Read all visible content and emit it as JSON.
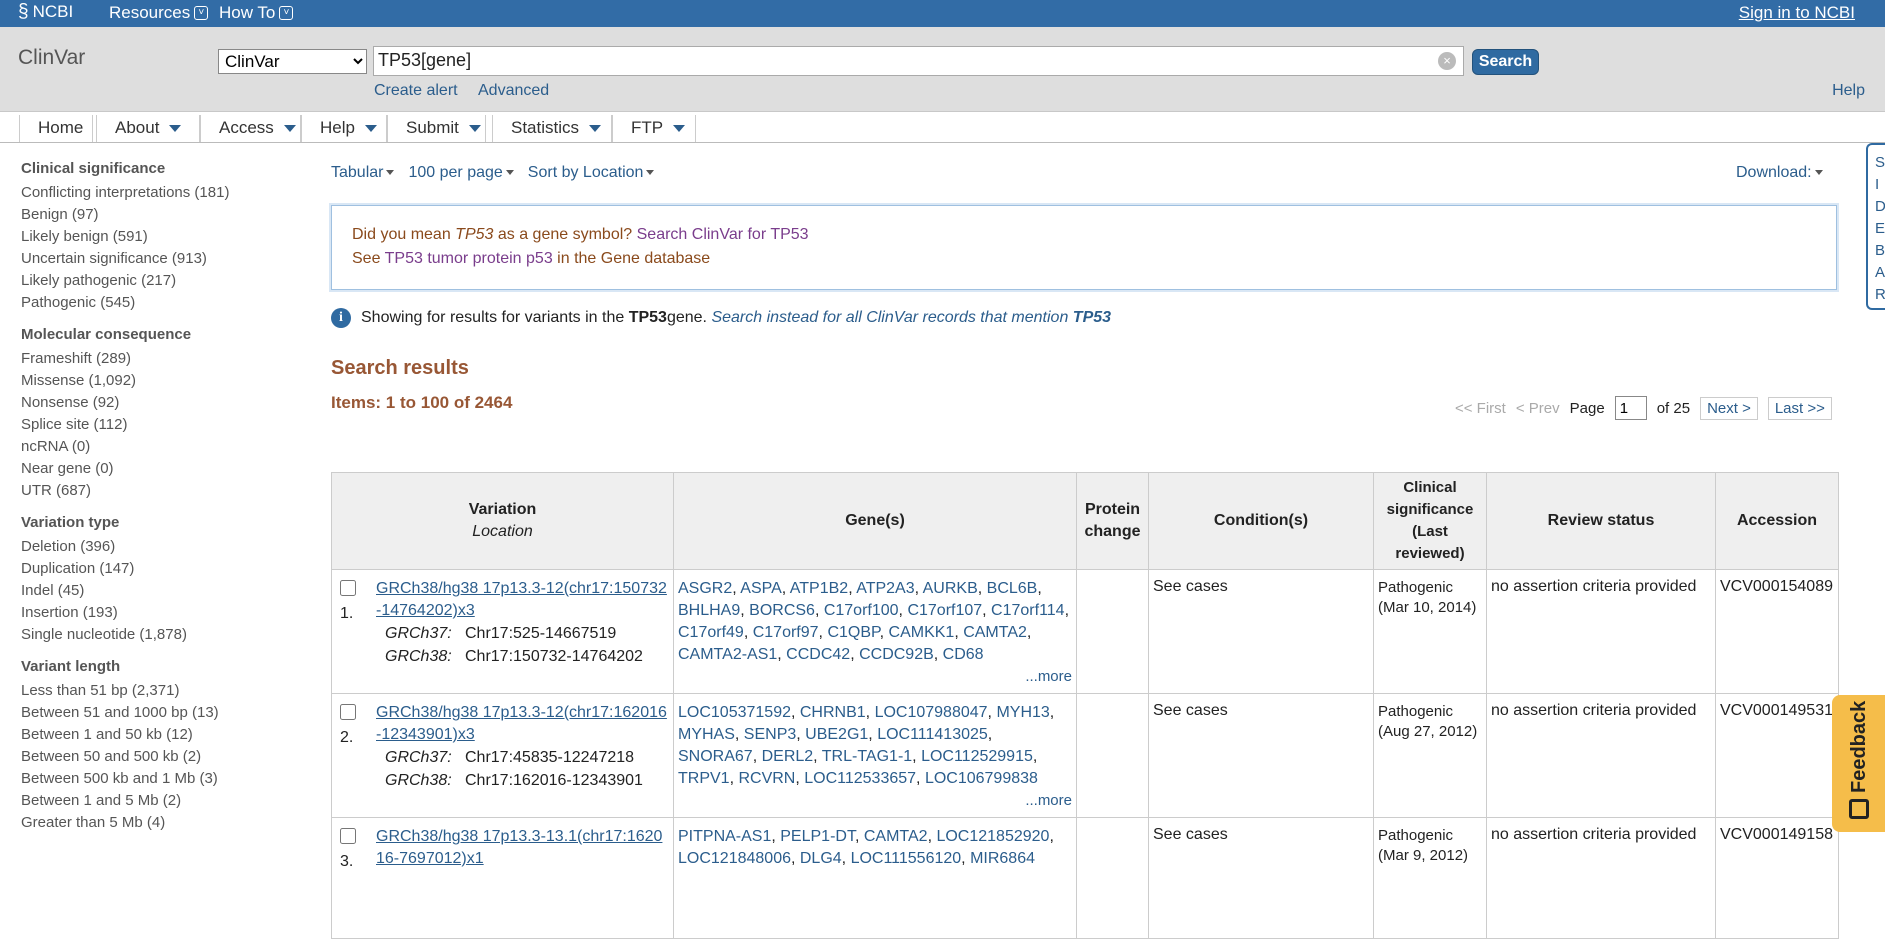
{
  "topbar": {
    "logo": "NCBI",
    "resources": "Resources",
    "howto": "How To",
    "signin": "Sign in to NCBI"
  },
  "search": {
    "db_title": "ClinVar",
    "db_selected": "ClinVar",
    "query": "TP53[gene]",
    "button": "Search",
    "create_alert": "Create alert",
    "advanced": "Advanced",
    "help": "Help"
  },
  "menu": [
    "Home",
    "About",
    "Access",
    "Help",
    "Submit",
    "Statistics",
    "FTP"
  ],
  "facets": [
    {
      "title": "Clinical significance",
      "items": [
        "Conflicting interpretations (181)",
        "Benign (97)",
        "Likely benign (591)",
        "Uncertain significance (913)",
        "Likely pathogenic (217)",
        "Pathogenic (545)"
      ]
    },
    {
      "title": "Molecular consequence",
      "items": [
        "Frameshift (289)",
        "Missense (1,092)",
        "Nonsense (92)",
        "Splice site (112)",
        "ncRNA (0)",
        "Near gene (0)",
        "UTR (687)"
      ]
    },
    {
      "title": "Variation type",
      "items": [
        "Deletion (396)",
        "Duplication (147)",
        "Indel (45)",
        "Insertion (193)",
        "Single nucleotide (1,878)"
      ]
    },
    {
      "title": "Variant length",
      "items": [
        "Less than 51 bp (2,371)",
        "Between 51 and 1000 bp (13)",
        "Between 1 and 50 kb (12)",
        "Between 50 and 500 kb (2)",
        "Between 500 kb and 1 Mb (3)",
        "Between 1 and 5 Mb (2)",
        "Greater than 5 Mb (4)"
      ]
    }
  ],
  "display": {
    "format": "Tabular",
    "per_page": "100 per page",
    "sort": "Sort by Location",
    "download": "Download:"
  },
  "didyoumean": {
    "prefix": "Did you mean ",
    "term": "TP53",
    "mid": " as a gene symbol? ",
    "link1": "Search ClinVar for TP53",
    "see": "See ",
    "link2": "TP53 tumor protein p53",
    "suffix": " in the Gene database"
  },
  "info": {
    "text1": "Showing for results for variants in the ",
    "gene": "TP53",
    "text2": " gene. ",
    "link_text": "Search instead for all ClinVar records that mention ",
    "link_gene": "TP53"
  },
  "results": {
    "title": "Search results",
    "items": "Items: 1 to 100 of 2464",
    "pager": {
      "first": "<< First",
      "prev": "< Prev",
      "page_label": "Page",
      "page": "1",
      "of": "of 25",
      "next": "Next >",
      "last": "Last >>"
    },
    "headers": {
      "variation": "Variation",
      "location": "Location",
      "genes": "Gene(s)",
      "protein": "Protein change",
      "conditions": "Condition(s)",
      "clinsig": "Clinical significance",
      "last_reviewed": "(Last reviewed)",
      "review": "Review status",
      "accession": "Accession"
    },
    "rows": [
      {
        "num": "1.",
        "variation": "GRCh38/hg38 17p13.3-12(chr17:150732-14764202)x3",
        "grch37_label": "GRCh37:",
        "grch37": "Chr17:525-14667519",
        "grch38_label": "GRCh38:",
        "grch38": "Chr17:150732-14764202",
        "genes": [
          "ASGR2",
          "ASPA",
          "ATP1B2",
          "ATP2A3",
          "AURKB",
          "BCL6B",
          "BHLHA9",
          "BORCS6",
          "C17orf100",
          "C17orf107",
          "C17orf114",
          "C17orf49",
          "C17orf97",
          "C1QBP",
          "CAMKK1",
          "CAMTA2",
          "CAMTA2-AS1",
          "CCDC42",
          "CCDC92B",
          "CD68"
        ],
        "more": "...more",
        "protein": "",
        "conditions": "See cases",
        "clinsig": "Pathogenic",
        "date": "(Mar 10, 2014)",
        "review": "no assertion criteria provided",
        "accession": "VCV000154089"
      },
      {
        "num": "2.",
        "variation": "GRCh38/hg38 17p13.3-12(chr17:162016-12343901)x3",
        "grch37_label": "GRCh37:",
        "grch37": "Chr17:45835-12247218",
        "grch38_label": "GRCh38:",
        "grch38": "Chr17:162016-12343901",
        "genes": [
          "LOC105371592",
          "CHRNB1",
          "LOC107988047",
          "MYH13",
          "MYHAS",
          "SENP3",
          "UBE2G1",
          "LOC111413025",
          "SNORA67",
          "DERL2",
          "TRL-TAG1-1",
          "LOC112529915",
          "TRPV1",
          "RCVRN",
          "LOC112533657",
          "LOC106799838"
        ],
        "more": "...more",
        "protein": "",
        "conditions": "See cases",
        "clinsig": "Pathogenic",
        "date": "(Aug 27, 2012)",
        "review": "no assertion criteria provided",
        "accession": "VCV000149531"
      },
      {
        "num": "3.",
        "variation": "GRCh38/hg38 17p13.3-13.1(chr17:162016-7697012)x1",
        "grch37_label": "",
        "grch37": "",
        "grch38_label": "",
        "grch38": "",
        "genes": [
          "PITPNA-AS1",
          "PELP1-DT",
          "CAMTA2",
          "LOC121852920",
          "LOC121848006",
          "DLG4",
          "LOC111556120",
          "MIR6864"
        ],
        "more": "",
        "protein": "",
        "conditions": "See cases",
        "clinsig": "Pathogenic",
        "date": "(Mar 9, 2012)",
        "review": "no assertion criteria provided",
        "accession": "VCV000149158"
      }
    ]
  },
  "sidetab": [
    "S",
    "I",
    "D",
    "E",
    "B",
    "A",
    "R"
  ],
  "feedback": "Feedback",
  "colors": {
    "topbar": "#326ca6",
    "accent": "#985735",
    "link": "#2b5d8c",
    "feedback": "#f5bd4a"
  }
}
